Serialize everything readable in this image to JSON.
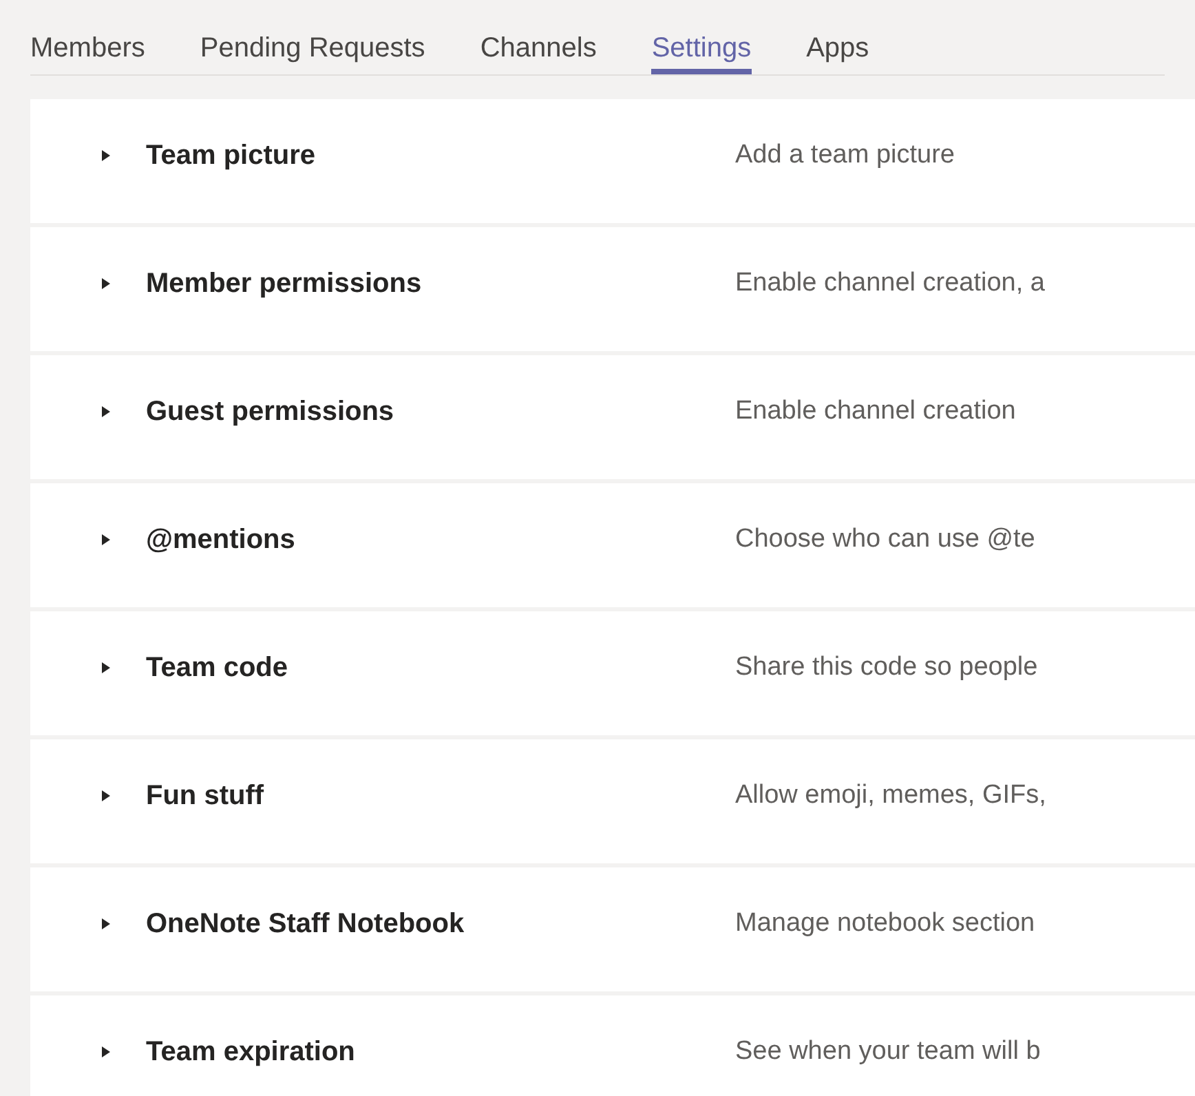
{
  "tabs": [
    {
      "label": "Members",
      "selected": false
    },
    {
      "label": "Pending Requests",
      "selected": false
    },
    {
      "label": "Channels",
      "selected": false
    },
    {
      "label": "Settings",
      "selected": true
    },
    {
      "label": "Apps",
      "selected": false
    }
  ],
  "settings": [
    {
      "title": "Team picture",
      "description": "Add a team picture",
      "expanded": false
    },
    {
      "title": "Member permissions",
      "description": "Enable channel creation, a",
      "expanded": false
    },
    {
      "title": "Guest permissions",
      "description": "Enable channel creation",
      "expanded": false
    },
    {
      "title": "@mentions",
      "description": "Choose who can use @te",
      "expanded": false
    },
    {
      "title": "Team code",
      "description": "Share this code so people",
      "expanded": false
    },
    {
      "title": "Fun stuff",
      "description": "Allow emoji, memes, GIFs,",
      "expanded": false
    },
    {
      "title": "OneNote Staff Notebook",
      "description": "Manage notebook section",
      "expanded": false
    },
    {
      "title": "Team expiration",
      "description": "See when your team will b",
      "expanded": false
    }
  ]
}
